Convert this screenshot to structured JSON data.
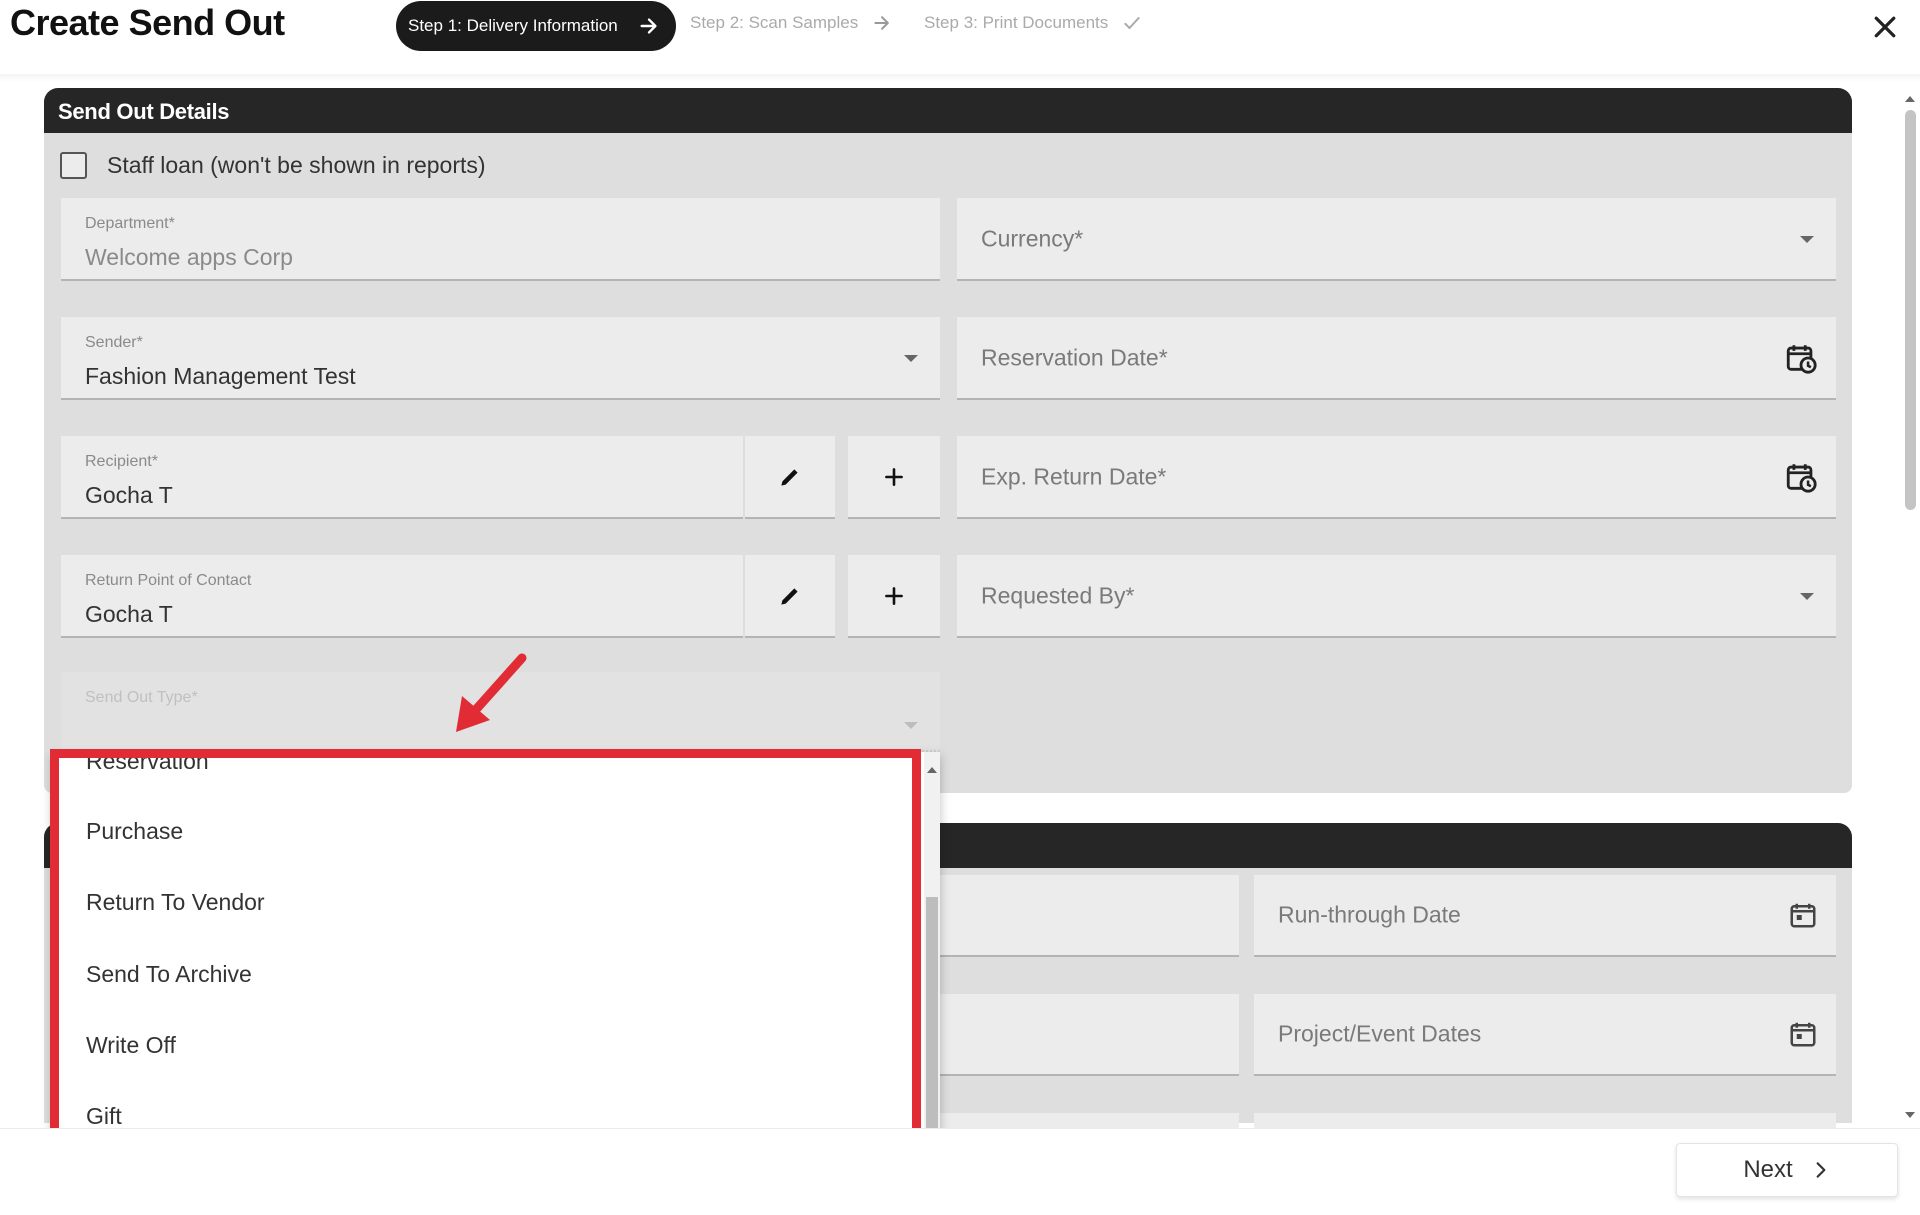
{
  "header": {
    "title": "Create Send Out",
    "steps": [
      {
        "label": "Step 1: Delivery Information",
        "icon": "arrow-right-icon",
        "active": true
      },
      {
        "label": "Step 2: Scan Samples",
        "icon": "arrow-right-icon",
        "active": false
      },
      {
        "label": "Step 3: Print Documents",
        "icon": "check-icon",
        "active": false
      }
    ],
    "close_icon": "close-icon"
  },
  "details": {
    "section_title": "Send Out Details",
    "staff_loan_label": "Staff loan (won't be shown in reports)",
    "staff_loan_checked": false,
    "department": {
      "label": "Department*",
      "value": "Welcome apps Corp"
    },
    "currency": {
      "placeholder": "Currency*"
    },
    "sender": {
      "label": "Sender*",
      "value": "Fashion Management Test"
    },
    "reservation_date": {
      "placeholder": "Reservation Date*"
    },
    "recipient": {
      "label": "Recipient*",
      "value": "Gocha T"
    },
    "exp_return_date": {
      "placeholder": "Exp. Return Date*"
    },
    "return_contact": {
      "label": "Return Point of Contact",
      "value": "Gocha T"
    },
    "requested_by": {
      "placeholder": "Requested By*"
    },
    "send_out_type": {
      "label": "Send Out Type*"
    }
  },
  "second_section": {
    "run_through_date": {
      "placeholder": "Run-through Date"
    },
    "project_event_dates": {
      "placeholder": "Project/Event Dates"
    }
  },
  "dropdown": {
    "options": [
      "Reservation",
      "Purchase",
      "Return To Vendor",
      "Send To Archive",
      "Write Off",
      "Gift"
    ]
  },
  "annotation": {
    "highlight_color": "#e12c35"
  },
  "footer": {
    "next_label": "Next"
  }
}
